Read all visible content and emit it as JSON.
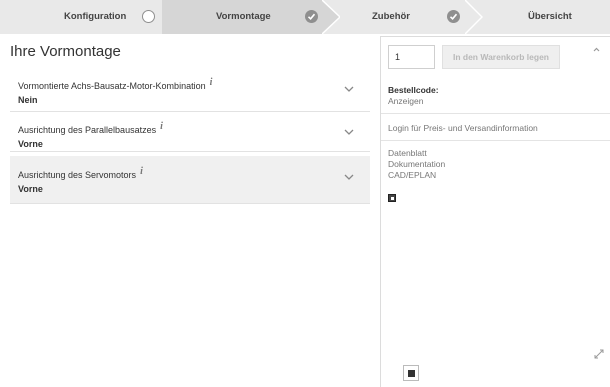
{
  "steps": [
    {
      "label": "Konfiguration",
      "status": "current"
    },
    {
      "label": "Vormontage",
      "status": "done"
    },
    {
      "label": "Zubehör",
      "status": "done"
    },
    {
      "label": "Übersicht",
      "status": "pending"
    }
  ],
  "main": {
    "title": "Ihre Vormontage",
    "options": [
      {
        "label": "Vormontierte Achs-Bausatz-Motor-Kombination",
        "value": "Nein"
      },
      {
        "label": "Ausrichtung des Parallelbausatzes",
        "value": "Vorne"
      },
      {
        "label": "Ausrichtung des Servomotors",
        "value": "Vorne"
      }
    ],
    "info_glyph": "i"
  },
  "panel": {
    "quantity": "1",
    "cart_button": "In den Warenkorb legen",
    "order_code_label": "Bestellcode:",
    "order_code_link": "Anzeigen",
    "login_text": "Login für Preis- und Versandinformation",
    "documents": [
      "Datenblatt",
      "Dokumentation",
      "CAD/EPLAN"
    ]
  },
  "colors": {
    "step_bar": "#e9e9e9",
    "step_active": "#d6d6d6",
    "active_row": "#f0f0f0",
    "text": "#333333",
    "muted": "#777777"
  },
  "icons": {
    "step_empty": "circle-outline-icon",
    "step_done": "check-circle-icon",
    "row_toggle": "chevron-down-icon",
    "panel_scroll": "chevron-up-icon",
    "preview": "image-placeholder-icon",
    "fullscreen": "expand-icon"
  }
}
